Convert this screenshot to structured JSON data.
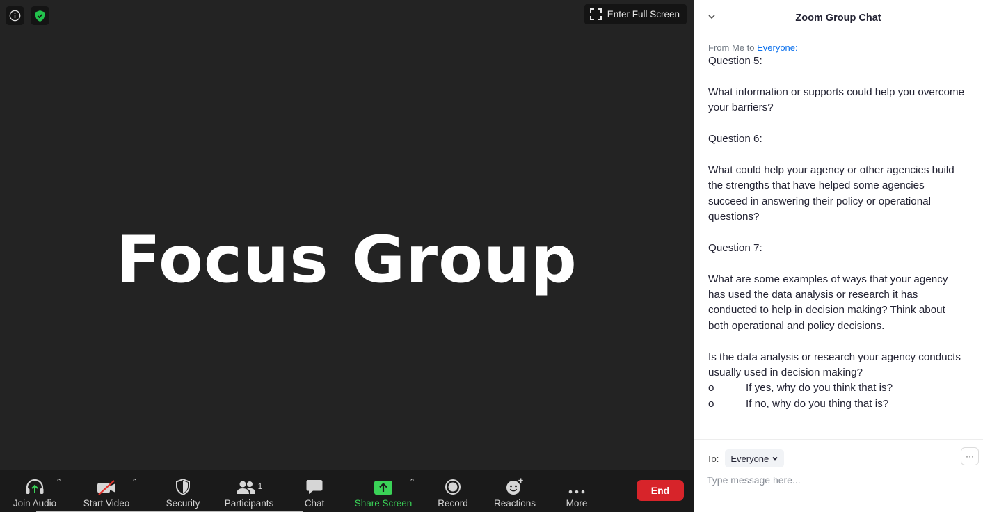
{
  "meeting": {
    "fullscreen_label": "Enter Full Screen",
    "shared_content_title": "Focus Group"
  },
  "toolbar": {
    "join_audio": "Join Audio",
    "start_video": "Start Video",
    "security": "Security",
    "participants": "Participants",
    "participants_count": "1",
    "chat": "Chat",
    "share_screen": "Share Screen",
    "record": "Record",
    "reactions": "Reactions",
    "more": "More",
    "end": "End"
  },
  "chat": {
    "title": "Zoom Group Chat",
    "message": {
      "from_prefix": "From Me to",
      "recipient": "Everyone:",
      "lines": [
        "Question 5:",
        "",
        "What information or supports could help you overcome your barriers?",
        "",
        "Question 6:",
        "",
        "What could help your agency or other agencies build the strengths that have helped some agencies succeed in answering their policy or operational questions?",
        "",
        "Question 7:",
        "",
        "What are some examples of ways that your agency has used the data analysis or research it has conducted to help in decision making? Think about both operational and policy decisions.",
        "",
        "Is the data analysis or research your agency conducts usually used in decision making?"
      ],
      "bullets": [
        {
          "marker": "o",
          "text": "If yes, why do you think that is?"
        },
        {
          "marker": "o",
          "text": "If no, why do you thing that is?"
        }
      ]
    },
    "to_label": "To:",
    "to_value": "Everyone",
    "input_placeholder": "Type message here...",
    "more_label": "···"
  },
  "colors": {
    "meeting_bg": "#232323",
    "toolbar_bg": "#1a1a1a",
    "accent_green": "#3ad257",
    "end_red": "#d7242a",
    "link_blue": "#0e72ed"
  }
}
